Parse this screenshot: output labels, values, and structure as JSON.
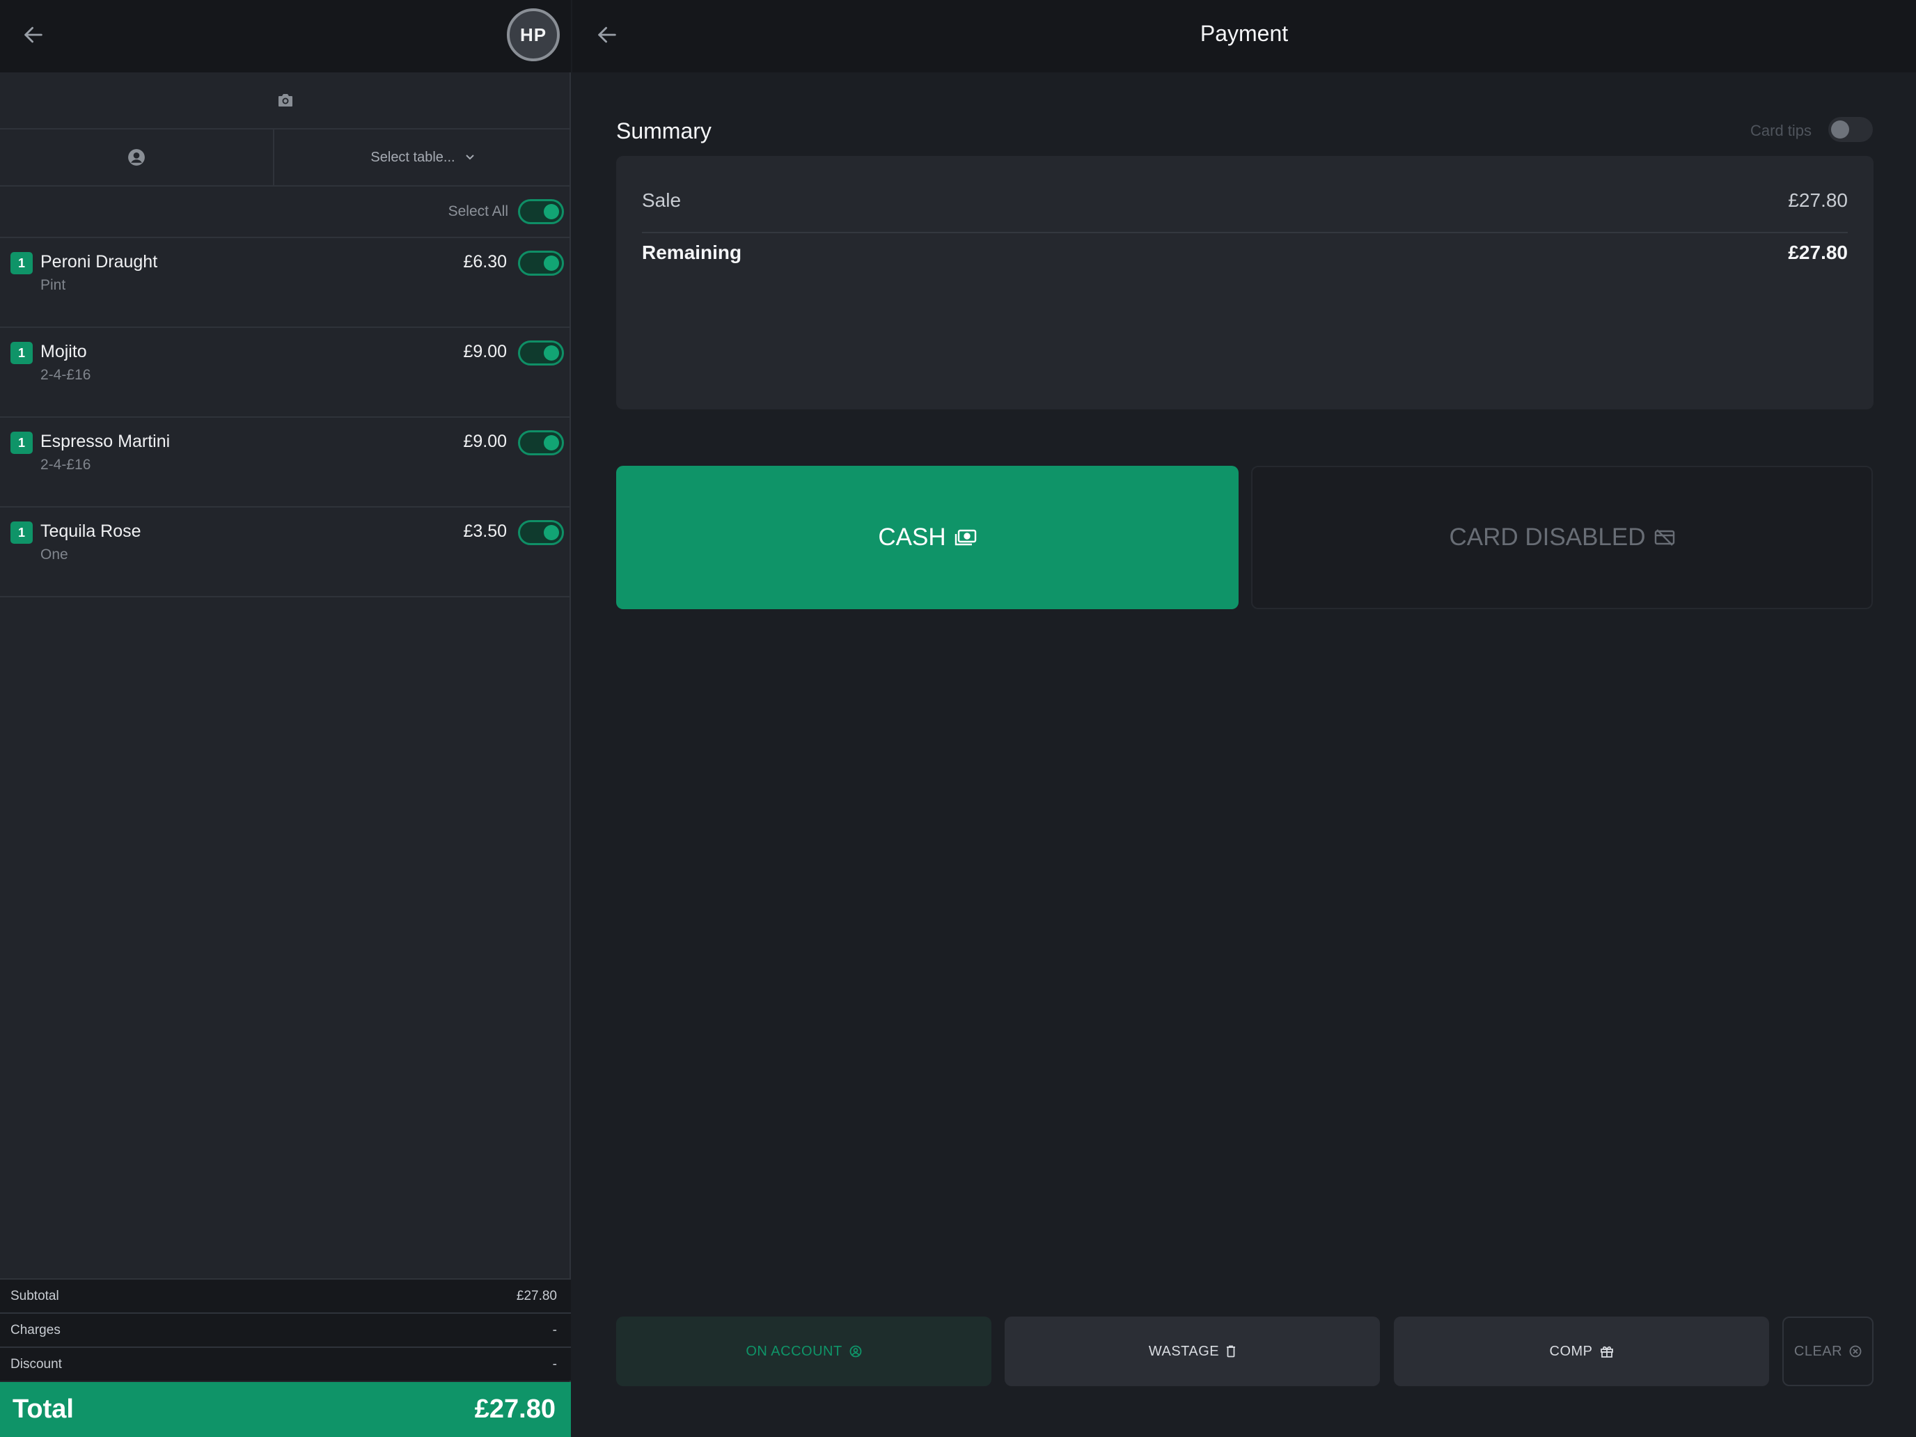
{
  "user": {
    "initials": "HP"
  },
  "order": {
    "table_placeholder": "Select table...",
    "select_all_label": "Select All",
    "items": [
      {
        "qty": "1",
        "name": "Peroni Draught",
        "sub": "Pint",
        "price": "£6.30",
        "selected": true
      },
      {
        "qty": "1",
        "name": "Mojito",
        "sub": "2-4-£16",
        "price": "£9.00",
        "selected": true
      },
      {
        "qty": "1",
        "name": "Espresso Martini",
        "sub": "2-4-£16",
        "price": "£9.00",
        "selected": true
      },
      {
        "qty": "1",
        "name": "Tequila Rose",
        "sub": "One",
        "price": "£3.50",
        "selected": true
      }
    ],
    "subtotal_label": "Subtotal",
    "subtotal_value": "£27.80",
    "charges_label": "Charges",
    "charges_value": "-",
    "discount_label": "Discount",
    "discount_value": "-",
    "total_label": "Total",
    "total_value": "£27.80"
  },
  "payment": {
    "title": "Payment",
    "summary_title": "Summary",
    "card_tips_label": "Card tips",
    "card_tips_enabled": false,
    "sale_label": "Sale",
    "sale_value": "£27.80",
    "remaining_label": "Remaining",
    "remaining_value": "£27.80",
    "cash_label": "CASH",
    "card_label": "CARD DISABLED",
    "on_account_label": "ON ACCOUNT",
    "wastage_label": "WASTAGE",
    "comp_label": "COMP",
    "clear_label": "CLEAR"
  },
  "colors": {
    "accent": "#0f9468",
    "background": "#1b1e23",
    "panel": "#22252b",
    "header": "#15171b"
  }
}
